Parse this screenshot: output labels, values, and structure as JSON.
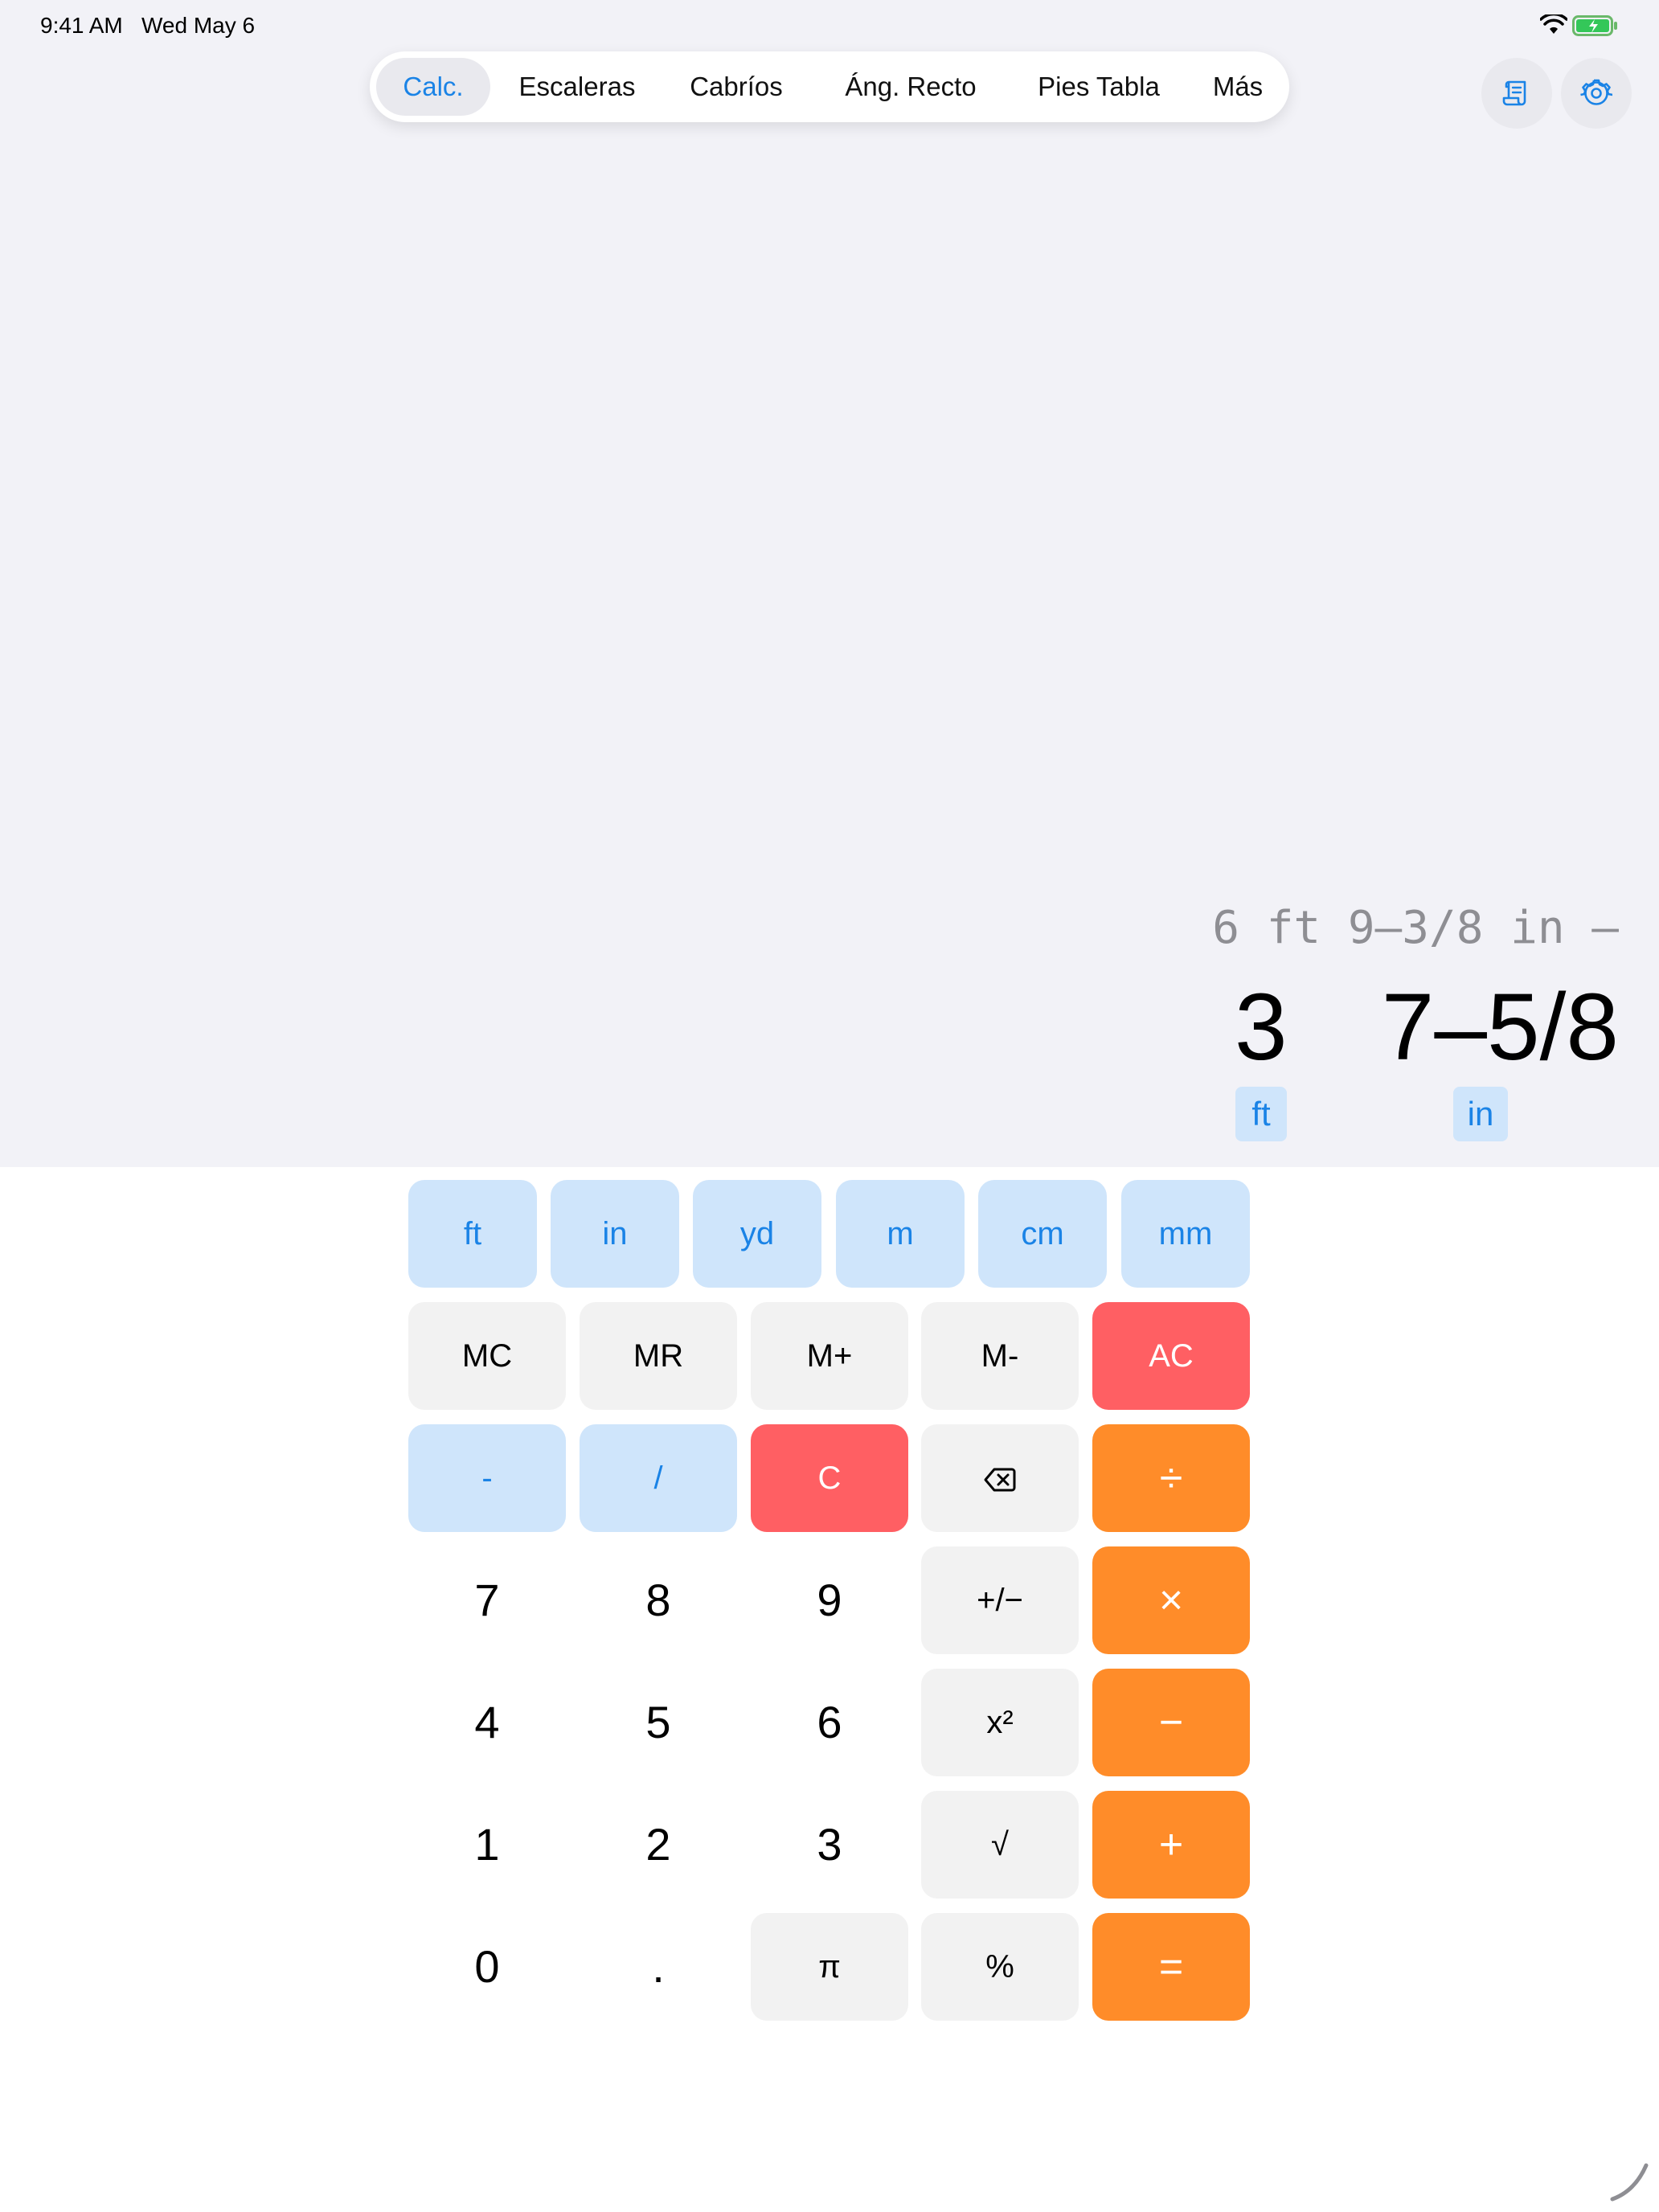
{
  "status": {
    "time": "9:41 AM",
    "date": "Wed May 6"
  },
  "tabs": [
    {
      "label": "Calc.",
      "active": true
    },
    {
      "label": "Escaleras",
      "active": false
    },
    {
      "label": "Cabríos",
      "active": false
    },
    {
      "label": "Áng. Recto",
      "active": false
    },
    {
      "label": "Pies Tabla",
      "active": false
    },
    {
      "label": "Más",
      "active": false
    }
  ],
  "toolbar_icons": {
    "history": "scroll-icon",
    "settings": "gear-icon"
  },
  "display": {
    "expression": "6 ft 9–3/8 in –",
    "result_feet": "3",
    "result_inches": "7–5/8",
    "feet_unit": "ft",
    "inches_unit": "in"
  },
  "keys": {
    "units": [
      "ft",
      "in",
      "yd",
      "m",
      "cm",
      "mm"
    ],
    "memory": [
      "MC",
      "MR",
      "M+",
      "M-"
    ],
    "all_clear": "AC",
    "dash": "-",
    "slash": "/",
    "clear": "C",
    "backspace_icon": "delete-backward-icon",
    "divide": "÷",
    "multiply": "×",
    "minus": "−",
    "plus": "+",
    "equals": "=",
    "digits": [
      "7",
      "8",
      "9",
      "4",
      "5",
      "6",
      "1",
      "2",
      "3",
      "0"
    ],
    "decimal": ".",
    "pi": "π",
    "percent": "%",
    "plus_minus": "+/−",
    "square": "x²",
    "sqrt": "√"
  },
  "colors": {
    "accent": "#1a83e6",
    "operator": "#ff8c29",
    "clear": "#ff5f63",
    "unit_key": "#cfe5fb",
    "function_key": "#f2f2f2",
    "background": "#f2f2f7"
  }
}
